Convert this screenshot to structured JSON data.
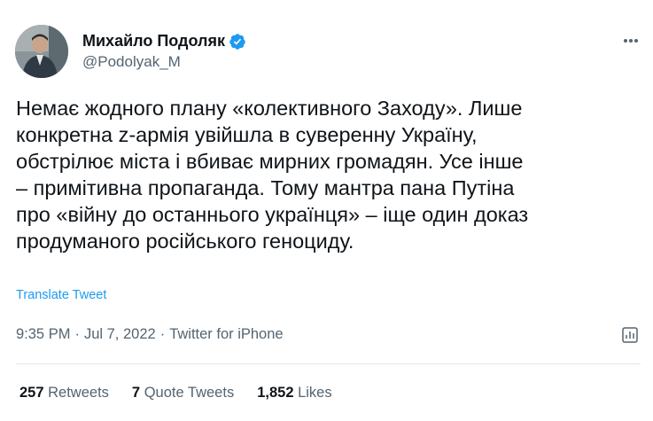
{
  "author": {
    "display_name": "Михайло Подоляк",
    "handle": "@Podolyak_M",
    "avatar_icon": "avatar-photo-icon",
    "verified_icon": "verified-badge-icon",
    "verified_color": "#1d9bf0"
  },
  "menu": {
    "more_icon": "more-horizontal-icon"
  },
  "tweet": {
    "lines": [
      "Немає жодного плану «колективного Заходу». Лише",
      "конкретна z-армія увійшла в суверенну Україну,",
      "обстрілює міста і вбиває мирних громадян. Усе інше",
      "– примітивна пропаганда. Тому мантра пана Путіна",
      "про «війну до останнього українця» – іще один доказ",
      "продуманого російського геноциду."
    ],
    "translate_label": "Translate Tweet"
  },
  "meta": {
    "time": "9:35 PM",
    "separator": "·",
    "date": "Jul 7, 2022",
    "source": "Twitter for iPhone",
    "analytics_icon": "analytics-icon"
  },
  "stats": {
    "retweets_count": "257",
    "retweets_label": "Retweets",
    "quotes_count": "7",
    "quotes_label": "Quote Tweets",
    "likes_count": "1,852",
    "likes_label": "Likes"
  },
  "colors": {
    "text": "#0f1419",
    "secondary": "#536471",
    "link": "#1d9bf0",
    "divider": "#e4e8eb"
  }
}
